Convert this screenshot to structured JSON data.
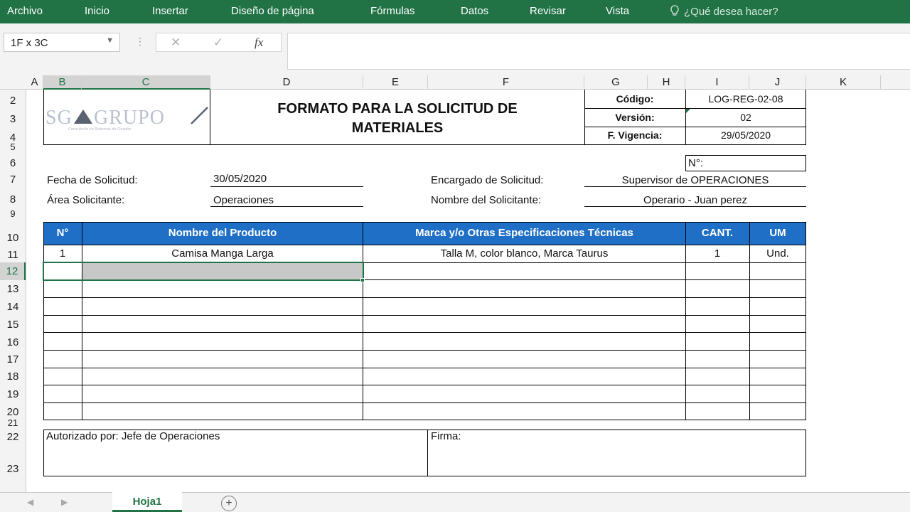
{
  "ribbon": {
    "tabs": [
      "Archivo",
      "Inicio",
      "Insertar",
      "Diseño de página",
      "Fórmulas",
      "Datos",
      "Revisar",
      "Vista"
    ],
    "tell_me": "¿Qué desea hacer?"
  },
  "formula_bar": {
    "name_box": "1F x 3C",
    "fx_label": "fx",
    "cancel_glyph": "✕",
    "enter_glyph": "✓",
    "content": ""
  },
  "columns": [
    "A",
    "B",
    "C",
    "D",
    "E",
    "F",
    "G",
    "H",
    "I",
    "J",
    "K"
  ],
  "rows": [
    "2",
    "3",
    "4",
    "5",
    "6",
    "7",
    "8",
    "9",
    "10",
    "11",
    "12",
    "13",
    "14",
    "15",
    "16",
    "17",
    "18",
    "19",
    "20",
    "21",
    "22",
    "23"
  ],
  "selected_cell": {
    "row": "12",
    "columns": [
      "B",
      "C"
    ]
  },
  "form": {
    "logo_text": "SG GRUPO",
    "logo_sub": "Consultoría en Sistemas de Gestión",
    "title_line1": "FORMATO PARA LA SOLICITUD DE",
    "title_line2": "MATERIALES",
    "codigo_label": "Código:",
    "codigo_value": "LOG-REG-02-08",
    "version_label": "Versión:",
    "version_value": "02",
    "vigencia_label": "F. Vigencia:",
    "vigencia_value": "29/05/2020",
    "numero_label": "N°:",
    "fecha_label": "Fecha de Solicitud:",
    "fecha_value": "30/05/2020",
    "area_label": "Área Solicitante:",
    "area_value": "Operaciones",
    "encargado_label": "Encargado de Solicitud:",
    "encargado_value": "Supervisor de OPERACIONES",
    "solicitante_label": "Nombre del Solicitante:",
    "solicitante_value": "Operario - Juan perez",
    "table_headers": [
      "N°",
      "Nombre del Producto",
      "Marca y/o Otras Especificaciones Técnicas",
      "CANT.",
      "UM"
    ],
    "table_rows": [
      [
        "1",
        "Camisa Manga Larga",
        "Talla M, color blanco, Marca Taurus",
        "1",
        "Und."
      ]
    ],
    "autorizado_label": "Autorizado por:  Jefe de Operaciones",
    "firma_label": "Firma:"
  },
  "sheet_tabs": [
    "Hoja1"
  ],
  "colors": {
    "ribbon": "#217346",
    "table_header": "#1f6fc6",
    "selection": "#217346"
  }
}
